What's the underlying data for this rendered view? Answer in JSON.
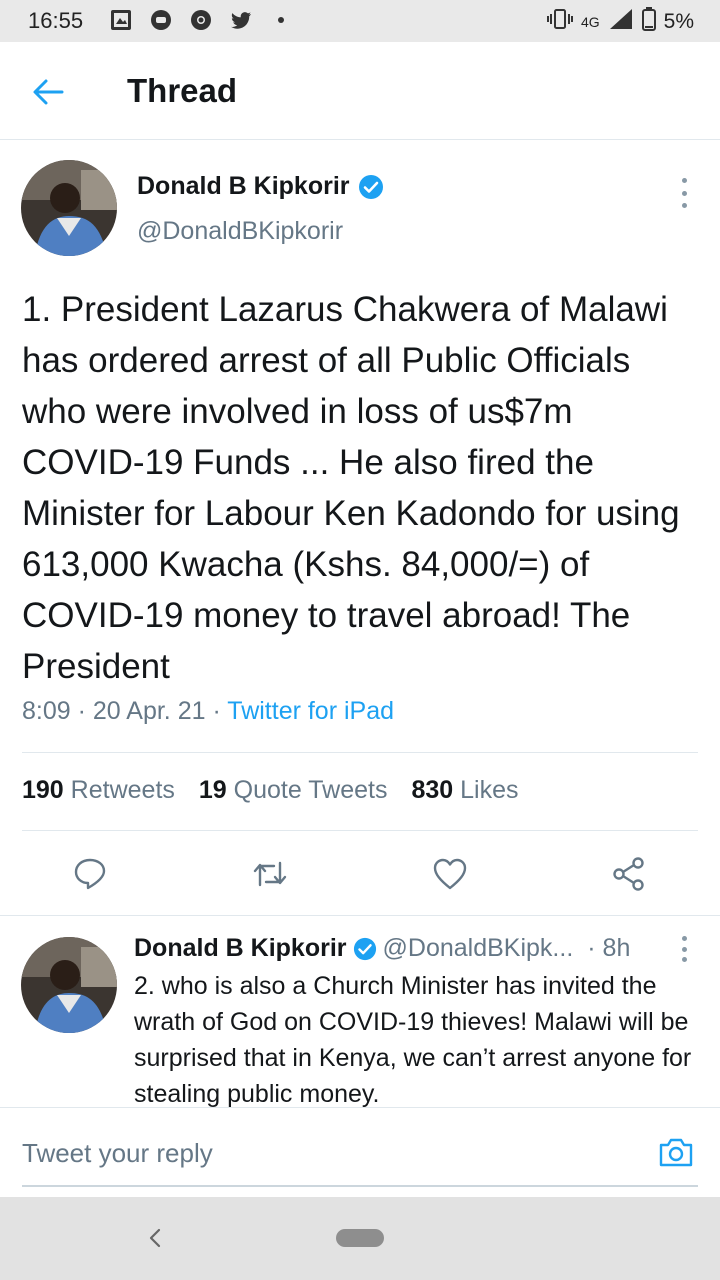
{
  "status_bar": {
    "time": "16:55",
    "network": "4G",
    "battery": "5%",
    "notification_icons": [
      "photo-icon",
      "messenger-icon",
      "chrome-icon",
      "twitter-icon",
      "dot-icon"
    ]
  },
  "header": {
    "title": "Thread",
    "back_icon": "arrow-left-icon"
  },
  "main_tweet": {
    "author_name": "Donald B Kipkorir",
    "author_handle": "@DonaldBKipkorir",
    "verified": true,
    "text": "1. President Lazarus Chakwera of Malawi has ordered arrest of all Public Officials who were involved in loss of us$7m COVID-19 Funds ... He also fired the Minister for Labour Ken Kadondo for using 613,000 Kwacha (Kshs. 84,000/=) of COVID-19 money to travel abroad! The President",
    "time": "8:09",
    "date": "20 Apr. 21",
    "source": "Twitter for iPad",
    "stats": {
      "retweets_count": "190",
      "retweets_label": "Retweets",
      "quotes_count": "19",
      "quotes_label": "Quote Tweets",
      "likes_count": "830",
      "likes_label": "Likes"
    }
  },
  "reply_tweet": {
    "author_name": "Donald B Kipkorir",
    "author_handle": "@DonaldBKipk...",
    "time": "· 8h",
    "verified": true,
    "text": "2. who is also a Church Minister has invited the wrath of God on COVID-19 thieves! Malawi will be surprised that in Kenya, we can’t arrest anyone for stealing public money."
  },
  "reply_bar": {
    "placeholder": "Tweet your reply"
  },
  "colors": {
    "accent": "#1da1f2",
    "secondary_text": "#657786",
    "primary_text": "#14171a",
    "divider": "#e1e8ed"
  }
}
